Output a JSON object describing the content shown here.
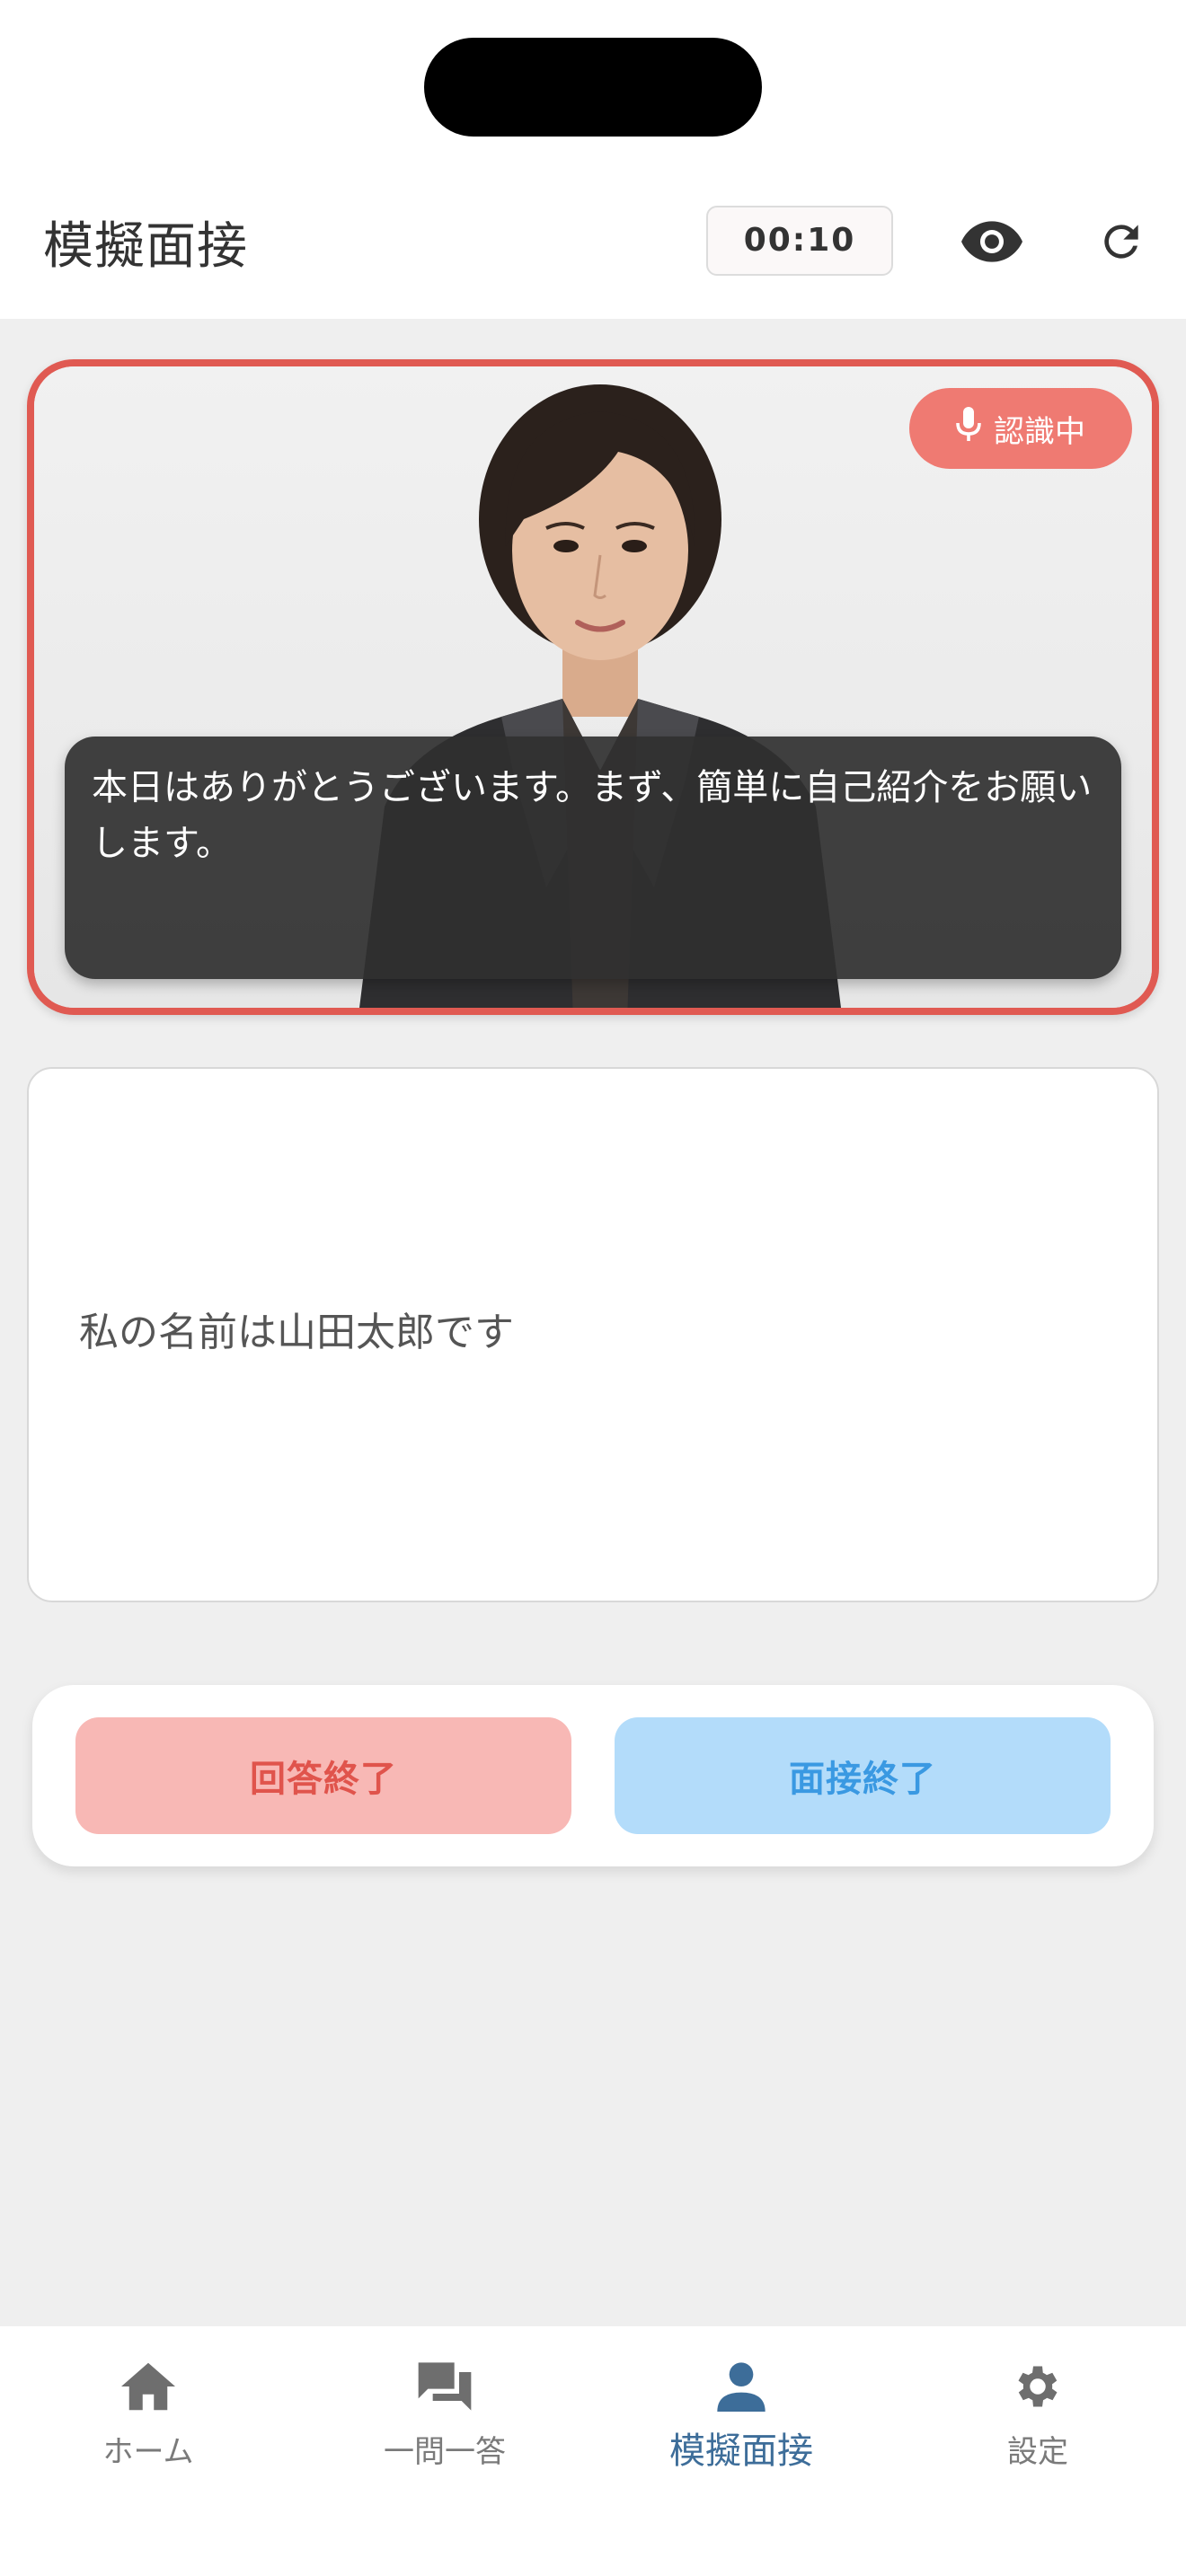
{
  "header": {
    "title": "模擬面接",
    "timer": "00:10",
    "eye_icon": "eye-icon",
    "refresh_icon": "refresh-icon"
  },
  "video": {
    "badge_label": "認識中",
    "badge_icon": "microphone-icon",
    "question_caption": "本日はありがとうございます。まず、簡単に自己紹介をお願いします。"
  },
  "transcript": {
    "text": "私の名前は山田太郎です"
  },
  "actions": {
    "answer_done_label": "回答終了",
    "interview_end_label": "面接終了"
  },
  "nav": {
    "items": [
      {
        "label": "ホーム",
        "icon": "home-icon",
        "active": false
      },
      {
        "label": "一問一答",
        "icon": "chat-icon",
        "active": false
      },
      {
        "label": "模擬面接",
        "icon": "person-icon",
        "active": true
      },
      {
        "label": "設定",
        "icon": "gear-icon",
        "active": false
      }
    ]
  },
  "colors": {
    "recording_border": "#e05a52",
    "badge": "#ef7a72",
    "answer_button_bg": "#f8b8b5",
    "answer_button_text": "#e0544c",
    "end_button_bg": "#b3dcfa",
    "end_button_text": "#3a99e2",
    "nav_active": "#3d6d99"
  }
}
